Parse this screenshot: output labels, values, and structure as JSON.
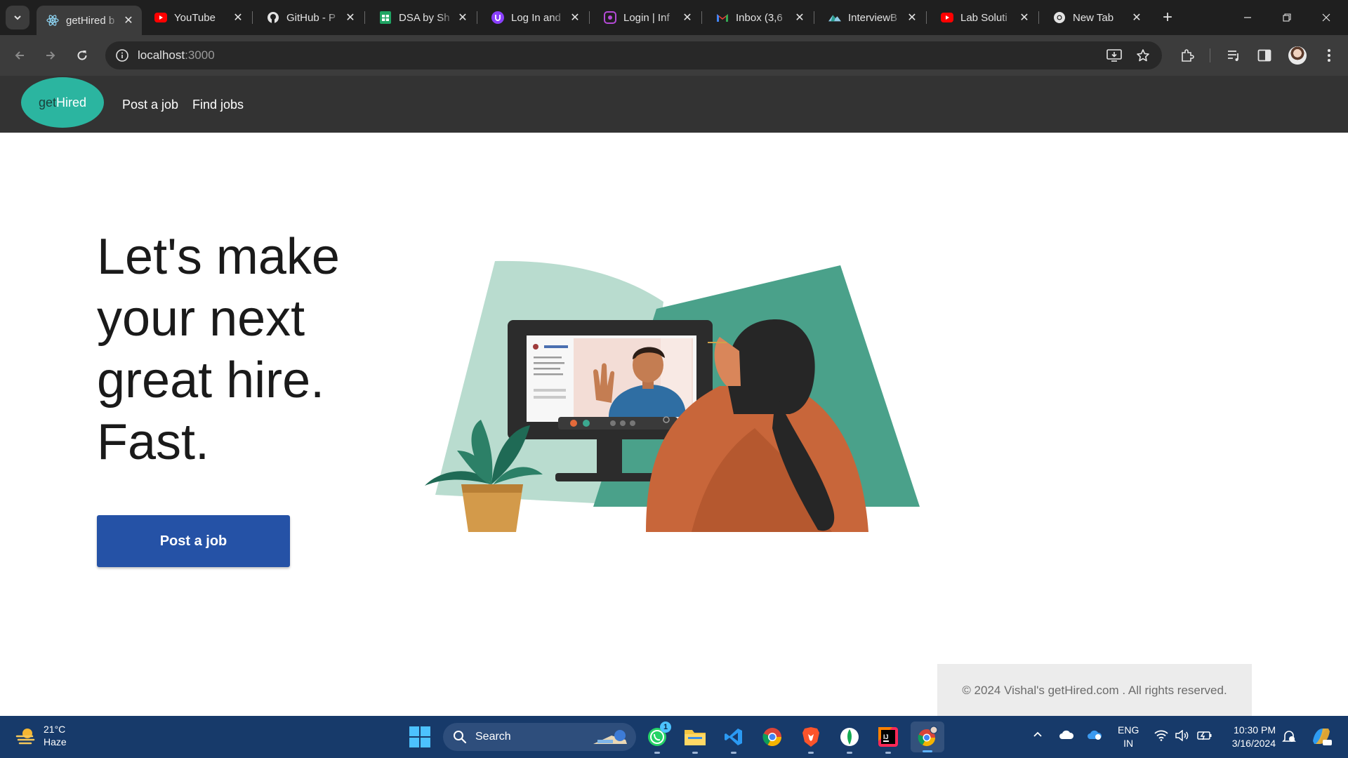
{
  "browser": {
    "tabs": [
      {
        "title": "getHired b",
        "icon": "react-icon",
        "active": true
      },
      {
        "title": "YouTube",
        "icon": "youtube-icon"
      },
      {
        "title": "GitHub - P",
        "icon": "github-icon"
      },
      {
        "title": "DSA by Sh",
        "icon": "google-sheets-icon"
      },
      {
        "title": "Log In and",
        "icon": "login-app-icon"
      },
      {
        "title": "Login | Inf",
        "icon": "infy-icon"
      },
      {
        "title": "Inbox (3,6",
        "icon": "gmail-icon"
      },
      {
        "title": "InterviewB",
        "icon": "interviewbit-icon"
      },
      {
        "title": "Lab Soluti",
        "icon": "youtube-icon"
      },
      {
        "title": "New Tab",
        "icon": "chrome-icon"
      }
    ],
    "url_host": "localhost",
    "url_port": ":3000"
  },
  "nav": {
    "logo_get": "get",
    "logo_hired": "Hired",
    "links": [
      "Post a job",
      "Find jobs"
    ]
  },
  "hero": {
    "headline_lines": [
      "Let's make",
      "your next",
      "great hire.",
      "Fast."
    ],
    "cta_label": "Post a job"
  },
  "footer": {
    "text": "© 2024 Vishal's getHired.com . All rights reserved."
  },
  "taskbar": {
    "weather_temp": "21°C",
    "weather_desc": "Haze",
    "search_label": "Search",
    "whatsapp_badge": "1",
    "lang_top": "ENG",
    "lang_bottom": "IN",
    "time": "10:30 PM",
    "date": "3/16/2024"
  },
  "colors": {
    "nav_bg": "#333333",
    "logo_bg": "#2bb5a0",
    "cta_bg": "#2552a6",
    "taskbar_bg": "#173a6a"
  }
}
